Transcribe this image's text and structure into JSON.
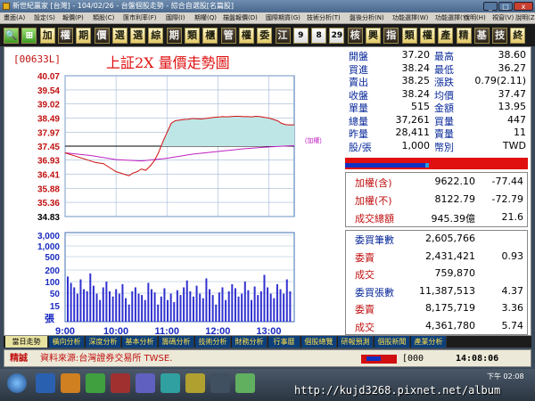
{
  "window": {
    "title": "新世紀贏家 [台灣] - 104/02/26 - 台盤個股走勢 - 綜合自選股[名篇股]",
    "min": "_",
    "max": "□",
    "close": "x"
  },
  "menu": [
    "畫面(A)",
    "設定(S)",
    "報價(P)",
    "類股(C)",
    "匯市利率(F)",
    "國際(I)",
    "期權(Q)",
    "描盤報價(D)",
    "國際期貨(G)",
    "技術分析(T)",
    "盤後分析(N)",
    "功能選擇(W)",
    "功能選擇(Y)",
    "說明(H)",
    "視窗(V)",
    "說明(Z)"
  ],
  "toolbar": {
    "items": [
      "🔍",
      "⊞",
      "加",
      "權",
      "期",
      "價",
      "選",
      "選",
      "綜",
      "期",
      "類",
      "櫃",
      "管",
      "權",
      "委",
      "江",
      "9",
      "8",
      "29",
      "核",
      "興",
      "指",
      "類",
      "權",
      "產",
      "精",
      "基",
      "技",
      "終"
    ]
  },
  "quote": {
    "code": "[00633L]",
    "title": "上証2X  量價走勢圖",
    "rows": [
      {
        "l1": "開盤",
        "v1": "37.20",
        "l2": "最高",
        "v2": "38.60"
      },
      {
        "l1": "買進",
        "v1": "38.24",
        "l2": "最低",
        "v2": "36.27"
      },
      {
        "l1": "賣出",
        "v1": "38.25",
        "l2": "漲跌",
        "v2": "0.79(2.11)"
      },
      {
        "l1": "收盤",
        "v1": "38.24",
        "l2": "均價",
        "v2": "37.47"
      },
      {
        "l1": "單量",
        "v1": "515",
        "l2": "金額",
        "v2": "13.95"
      },
      {
        "l1": "總量",
        "v1": "37,261",
        "l2": "買量",
        "v2": "447"
      },
      {
        "l1": "昨量",
        "v1": "28,411",
        "l2": "賣量",
        "v2": "11"
      },
      {
        "l1": "股/張",
        "v1": "1,000",
        "l2": "幣別",
        "v2": "TWD"
      }
    ]
  },
  "index_box": [
    {
      "label": "加權(含)",
      "value": "9622.10",
      "change": "-77.44"
    },
    {
      "label": "加權(不)",
      "value": "8122.79",
      "change": "-72.79"
    },
    {
      "label": "成交總額",
      "value": "945.39億",
      "change": "21.6"
    }
  ],
  "stats_box": [
    {
      "label": "委買筆數",
      "value": "2,605,766",
      "change": ""
    },
    {
      "label": "委賣",
      "value": "2,431,421",
      "change": "0.93"
    },
    {
      "label": "成交",
      "value": "759,870",
      "change": ""
    },
    {
      "label": "委買張數",
      "value": "11,387,513",
      "change": "4.37"
    },
    {
      "label": "委賣",
      "value": "8,175,719",
      "change": "3.36"
    },
    {
      "label": "成交",
      "value": "4,361,780",
      "change": "5.74"
    }
  ],
  "chart_data": {
    "type": "line",
    "title": "上証2X  量價走勢圖",
    "price_ticks": [
      "40.07",
      "39.54",
      "39.02",
      "38.49",
      "37.97",
      "37.45",
      "36.93",
      "36.41",
      "35.88",
      "35.36",
      "34.83"
    ],
    "price_ylim": [
      34.83,
      40.07
    ],
    "reference_price": 37.45,
    "ref_note": "(加權)",
    "volume_ticks": [
      "3,000",
      "1,000",
      "500",
      "200",
      "100",
      "50",
      "15"
    ],
    "volume_unit": "張",
    "x_ticks": [
      "9:00",
      "10:00",
      "11:00",
      "12:00",
      "13:00"
    ],
    "x_minutes": [
      0,
      270
    ],
    "price_series": [
      {
        "name": "price",
        "x": [
          0,
          5,
          10,
          15,
          20,
          25,
          30,
          35,
          40,
          45,
          50,
          55,
          60,
          65,
          70,
          75,
          80,
          85,
          90,
          95,
          100,
          105,
          110,
          115,
          120,
          125,
          130,
          135,
          140,
          145,
          150,
          155,
          160,
          165,
          170,
          175,
          180,
          185,
          190,
          195,
          200,
          205,
          210,
          215,
          220,
          225,
          230,
          235,
          240,
          245,
          250,
          255,
          260,
          265,
          270
        ],
        "values": [
          37.2,
          37.15,
          37.1,
          37.05,
          37.0,
          36.95,
          36.9,
          36.85,
          36.82,
          36.8,
          36.7,
          36.6,
          36.5,
          36.45,
          36.4,
          36.35,
          36.45,
          36.5,
          36.6,
          36.55,
          36.7,
          36.9,
          37.2,
          37.6,
          37.95,
          38.3,
          38.4,
          38.42,
          38.44,
          38.45,
          38.48,
          38.47,
          38.46,
          38.48,
          38.5,
          38.52,
          38.53,
          38.55,
          38.54,
          38.55,
          38.56,
          38.56,
          38.55,
          38.55,
          38.54,
          38.56,
          38.55,
          38.52,
          38.5,
          38.45,
          38.4,
          38.3,
          38.25,
          38.24,
          38.24
        ]
      },
      {
        "name": "avg",
        "x": [
          0,
          30,
          60,
          90,
          120,
          150,
          180,
          210,
          240,
          270
        ],
        "values": [
          37.2,
          37.1,
          36.95,
          36.9,
          37.0,
          37.15,
          37.25,
          37.35,
          37.42,
          37.47
        ]
      }
    ],
    "volume_series": {
      "name": "volume",
      "values": [
        180,
        120,
        90,
        60,
        150,
        80,
        70,
        220,
        100,
        60,
        40,
        90,
        130,
        70,
        50,
        80,
        60,
        110,
        45,
        30,
        70,
        90,
        60,
        55,
        40,
        120,
        80,
        65,
        30,
        50,
        85,
        40,
        60,
        35,
        75,
        55,
        90,
        140,
        70,
        50,
        100,
        60,
        45,
        160,
        80,
        55,
        30,
        65,
        90,
        40,
        70,
        110,
        85,
        50,
        60,
        130,
        75,
        40,
        95,
        55,
        70,
        200,
        90,
        60,
        45,
        110,
        80,
        60,
        150,
        70
      ]
    },
    "colors": {
      "price": "#d01010",
      "avg": "#c020c0",
      "fill": "#bfe6e6",
      "volume": "#3030d0",
      "ref": "#000000"
    }
  },
  "tabs": [
    "當日走勢",
    "橫向分析",
    "深度分析",
    "基本分析",
    "籌碼分析",
    "技術分析",
    "財務分析",
    "行事曆",
    "個股總覽",
    "研報預測",
    "個股新聞",
    "產業分析"
  ],
  "status": {
    "tag": "精誠",
    "source": "資料來源:台灣證券交易所 TWSE.",
    "code": "[000",
    "time": "14:08:06"
  },
  "watermark": "http://kujd3268.pixnet.net/album",
  "taskbar": {
    "time": "下午 02:08"
  }
}
